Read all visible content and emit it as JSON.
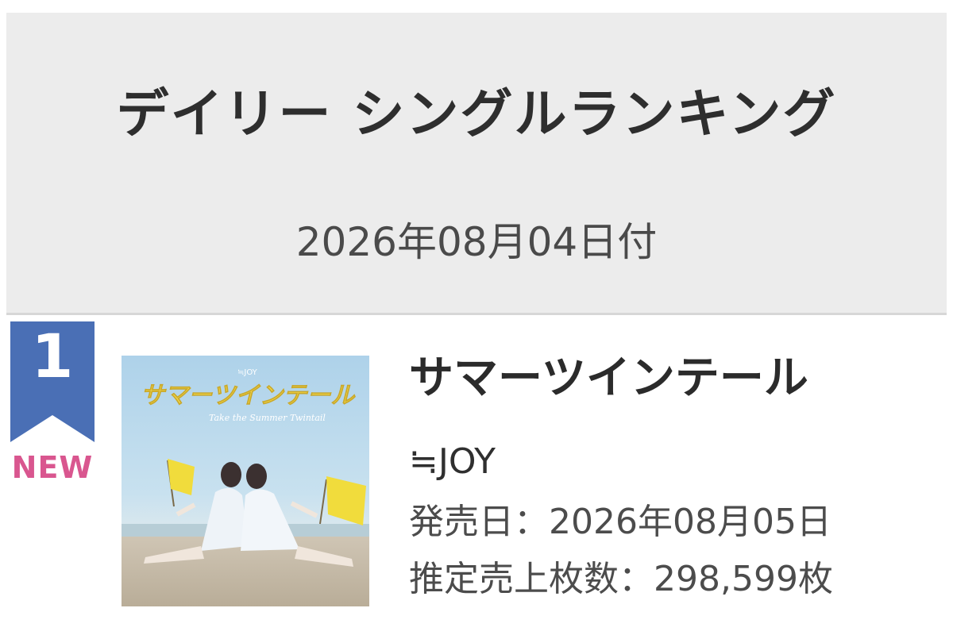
{
  "header": {
    "title": "デイリー シングルランキング",
    "date": "2026年08月04日付"
  },
  "entry": {
    "rank": "1",
    "status": "NEW",
    "song_title": "サマーツインテール",
    "artist": "≒JOY",
    "release_label": "発売日",
    "release_date": "2026年08月05日",
    "sales_label": "推定売上枚数",
    "sales_value": "298,599枚",
    "separator": "："
  },
  "jacket": {
    "title_logo": "サマーツインテール",
    "brand_small": "≒JOY",
    "subtitle_script": "Take the Summer Twintail",
    "icons": [
      "flag-icon",
      "flag-icon"
    ]
  },
  "colors": {
    "rank_badge": "#4a6fb5",
    "new_label": "#d9568f",
    "header_bg": "#ececec"
  }
}
